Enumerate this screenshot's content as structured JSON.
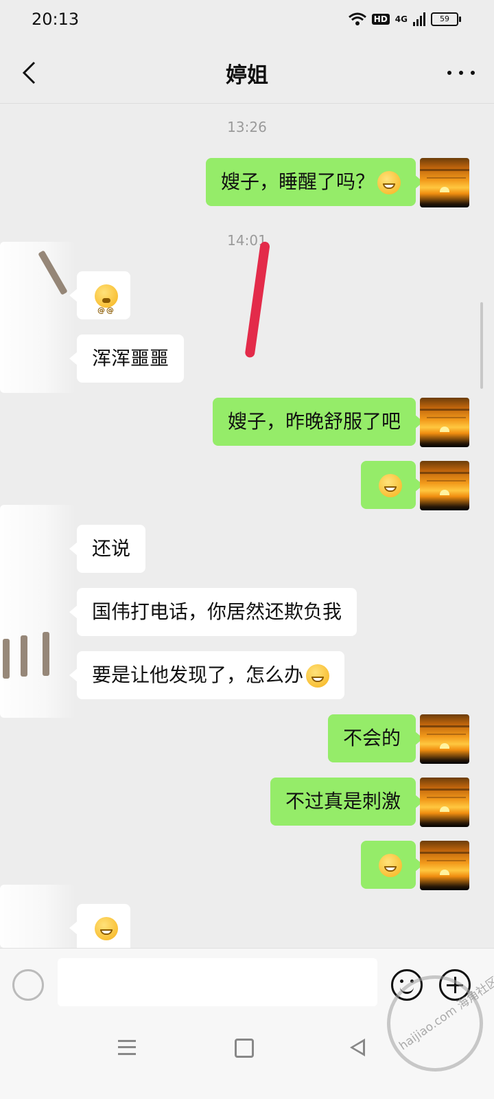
{
  "status_bar": {
    "time": "20:13",
    "hd": "HD",
    "network": "4G",
    "battery": "59"
  },
  "header": {
    "title": "婷姐"
  },
  "messages": [
    {
      "type": "timestamp",
      "text": "13:26"
    },
    {
      "type": "sent",
      "text": "嫂子，睡醒了吗？",
      "emoji": "grin-emoji"
    },
    {
      "type": "timestamp",
      "text": "14:01"
    },
    {
      "type": "received",
      "text": "",
      "emoji": "dizzy-emoji"
    },
    {
      "type": "received",
      "text": "浑浑噩噩"
    },
    {
      "type": "sent",
      "text": "嫂子，昨晚舒服了吧"
    },
    {
      "type": "sent",
      "text": "",
      "emoji": "grin-emoji"
    },
    {
      "type": "received",
      "text": "还说"
    },
    {
      "type": "received",
      "text": "国伟打电话，你居然还欺负我"
    },
    {
      "type": "received",
      "text": "要是让他发现了，怎么办",
      "emoji": "rofl-emoji"
    },
    {
      "type": "sent",
      "text": "不会的"
    },
    {
      "type": "sent",
      "text": "不过真是刺激"
    },
    {
      "type": "sent",
      "text": "",
      "emoji": "smile-emoji"
    },
    {
      "type": "received",
      "text": "",
      "emoji": "emoji-partial"
    }
  ],
  "input": {
    "placeholder": ""
  },
  "watermark": {
    "text": "haijiao.com 海角社区"
  },
  "colors": {
    "sent_bubble": "#95ec69",
    "received_bubble": "#ffffff",
    "background": "#ededed",
    "annotation": "#e32b4a"
  }
}
